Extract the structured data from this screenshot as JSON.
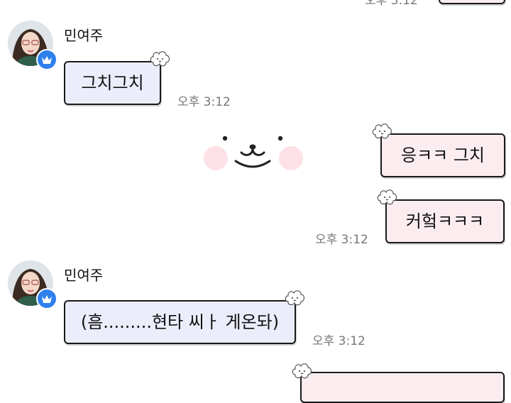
{
  "chat": {
    "sender_name": "민여주",
    "colors": {
      "received_bubble": "#ecedfb",
      "sent_bubble": "#fbecef",
      "crown_badge": "#2f80ed"
    },
    "messages": [
      {
        "from": "received",
        "text": "그치그치",
        "time": "오후 3:12"
      },
      {
        "from": "sent",
        "text": "응ㅋㅋ 그치"
      },
      {
        "from": "sent",
        "text": "커헠ㅋㅋㅋ",
        "time": "오후 3:12"
      },
      {
        "from": "received",
        "text": "(흠.........현타 씨ㅏ 게온돠)",
        "time": "오후 3:12"
      }
    ],
    "top_cut_time": "오후 3:12",
    "sticker": "cute-face-sticker",
    "bubble_decoration": "flower-sticker-icon",
    "badge_icon": "crown-icon"
  }
}
